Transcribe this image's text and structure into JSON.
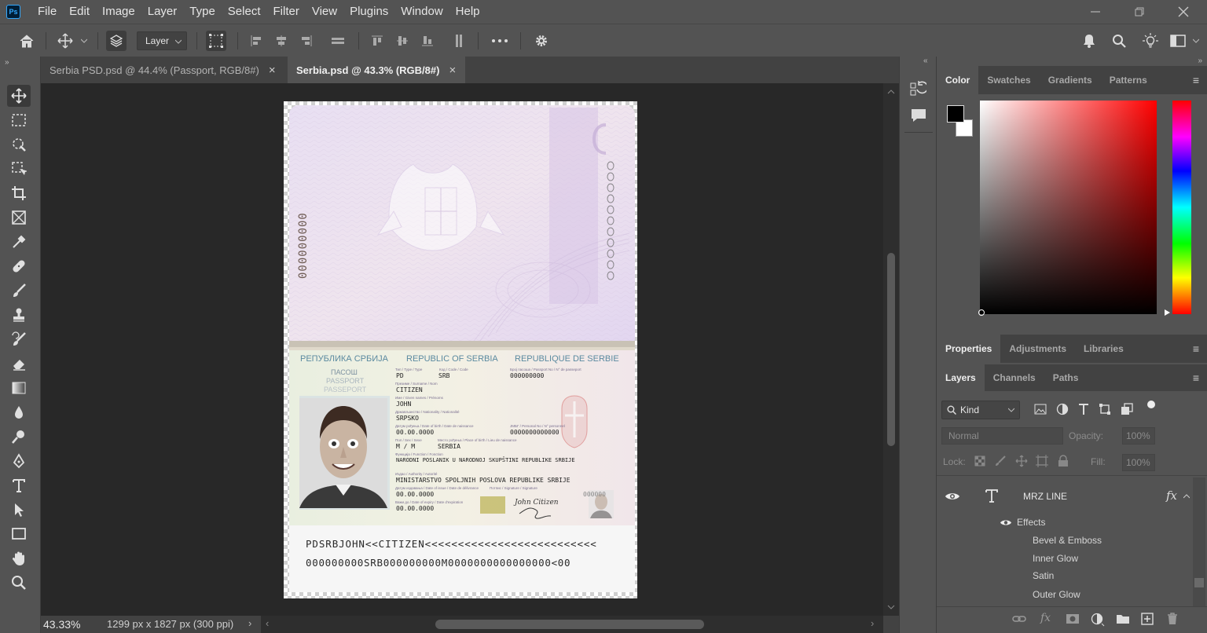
{
  "app": {
    "logo": "Ps"
  },
  "menu": [
    "File",
    "Edit",
    "Image",
    "Layer",
    "Type",
    "Select",
    "Filter",
    "View",
    "Plugins",
    "Window",
    "Help"
  ],
  "window_controls": {
    "minimize": "minimize-icon",
    "maximize": "maximize-icon",
    "close": "close-icon"
  },
  "options_bar": {
    "layer_select": "Layer"
  },
  "tabs": [
    {
      "label": "Serbia PSD.psd @ 44.4% (Passport, RGB/8#)",
      "active": false
    },
    {
      "label": "Serbia.psd @ 43.3% (RGB/8#)",
      "active": true
    }
  ],
  "status": {
    "zoom": "43.33%",
    "doc_info": "1299 px x 1827 px (300 ppi)"
  },
  "color_panel": {
    "tabs": [
      "Color",
      "Swatches",
      "Gradients",
      "Patterns"
    ],
    "foreground": "#000000",
    "background": "#ffffff",
    "hue_color": "#ff0000"
  },
  "properties_panel": {
    "tabs": [
      "Properties",
      "Adjustments",
      "Libraries"
    ]
  },
  "layers_panel": {
    "tabs": [
      "Layers",
      "Channels",
      "Paths"
    ],
    "filter_kind": "Kind",
    "blend_mode": "Normal",
    "opacity_label": "Opacity:",
    "opacity_value": "100%",
    "lock_label": "Lock:",
    "fill_label": "Fill:",
    "fill_value": "100%",
    "layer_name": "MRZ LINE",
    "effects_label": "Effects",
    "effects": [
      "Bevel & Emboss",
      "Inner Glow",
      "Satin",
      "Outer Glow"
    ]
  },
  "passport": {
    "serial_vertical": "000000000",
    "header_cyr": "РЕПУБЛИКА СРБИЈА",
    "header_en": "REPUBLIC OF SERBIA",
    "header_fr": "REPUBLIQUE DE SERBIE",
    "doc_word_cyr": "ПАСОШ",
    "doc_word_en": "PASSPORT",
    "doc_word_fr": "PASSEPORT",
    "labels": {
      "type": "Тип / Type / Type",
      "code": "Код / Code / Code",
      "passport_no": "Број пасоша / Passport No / N° de passeport",
      "surname": "Презиме / Surname / Nom",
      "given": "Име / Given names / Prénoms",
      "nationality": "Држављанство / Nationality / Nationalité",
      "dob": "Датум рођења / Date of birth / Date de naissance",
      "pid": "ЈМБГ / Personal No / N° personnel",
      "sex": "Пол / Sex / Sexe",
      "pob": "Место рођења / Place of birth / Lieu de naissance",
      "function": "Функција / Function / Fonction",
      "authority": "Издао / Authority / Autorité",
      "doi": "Датум издавања / Date of issue / Date de délivrance",
      "signature": "Потпис / Signature / Signature",
      "doe": "Важи до / Date of expiry / Date d'expiration"
    },
    "type": "PD",
    "code": "SRB",
    "passport_no": "000000000",
    "surname": "CITIZEN",
    "given": "JOHN",
    "nationality": "SRPSKO",
    "dob": "00.00.0000",
    "pid": "0000000000000",
    "sex": "M / M",
    "pob": "SERBIA",
    "function": "NARODNI POSLANIK U NARODNOJ SKUPŠTINI REPUBLIKE SRBIJE",
    "authority": "MINISTARSTVO SPOLJNIH POSLOVA REPUBLIKE SRBIJE",
    "doi": "00.00.0000",
    "doe": "00.00.0000",
    "mini_no": "000000",
    "signature_text": "John Citizen",
    "mrz1": "PDSRBJOHN<<CITIZEN<<<<<<<<<<<<<<<<<<<<<<<<<<",
    "mrz2": "000000000SRB000000000M0000000000000000<00"
  }
}
